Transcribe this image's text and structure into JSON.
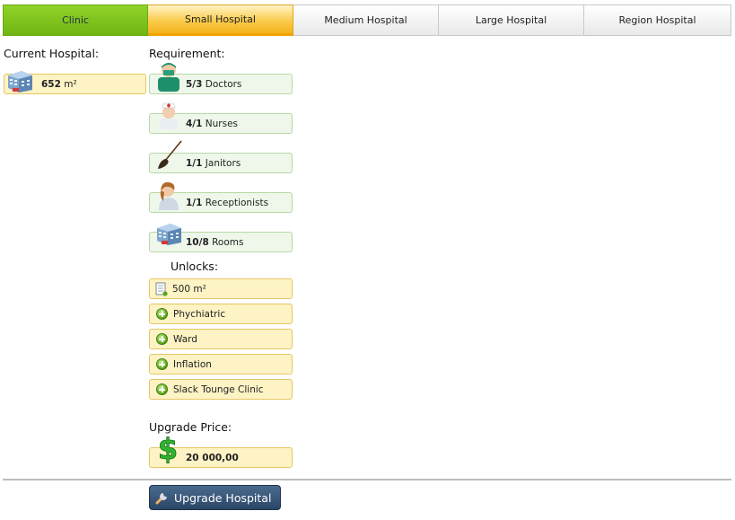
{
  "tabs": [
    {
      "label": "Clinic",
      "state": "done"
    },
    {
      "label": "Small Hospital",
      "state": "active"
    },
    {
      "label": "Medium Hospital",
      "state": "normal"
    },
    {
      "label": "Large Hospital",
      "state": "normal"
    },
    {
      "label": "Region Hospital",
      "state": "normal"
    }
  ],
  "current": {
    "heading": "Current Hospital:",
    "size": "652",
    "unit": "m²",
    "icon": "hospital-building-icon"
  },
  "requirement": {
    "heading": "Requirement:",
    "items": [
      {
        "value": "5/3",
        "label": "Doctors",
        "icon": "doctor-icon"
      },
      {
        "value": "4/1",
        "label": "Nurses",
        "icon": "nurse-icon"
      },
      {
        "value": "1/1",
        "label": "Janitors",
        "icon": "broom-icon"
      },
      {
        "value": "1/1",
        "label": "Receptionists",
        "icon": "receptionist-icon"
      },
      {
        "value": "10/8",
        "label": "Rooms",
        "icon": "hospital-building-icon"
      }
    ]
  },
  "unlocks": {
    "heading": "Unlocks:",
    "items": [
      {
        "label": "500 m²",
        "icon": "floorplan-icon"
      },
      {
        "label": "Phychiatric",
        "icon": "plus-icon"
      },
      {
        "label": "Ward",
        "icon": "plus-icon"
      },
      {
        "label": "Inflation",
        "icon": "plus-icon"
      },
      {
        "label": "Slack Tounge Clinic",
        "icon": "plus-icon"
      }
    ]
  },
  "price": {
    "heading": "Upgrade Price:",
    "value": "20 000,00",
    "icon": "dollar-icon"
  },
  "button": {
    "label": "Upgrade Hospital",
    "icon": "wrench-icon"
  },
  "colors": {
    "done_tab": "#7cc11b",
    "active_tab": "#f7c02f",
    "green_box": "#eef7ea",
    "yellow_box": "#fdf3c4",
    "button": "#2f4c6e"
  }
}
